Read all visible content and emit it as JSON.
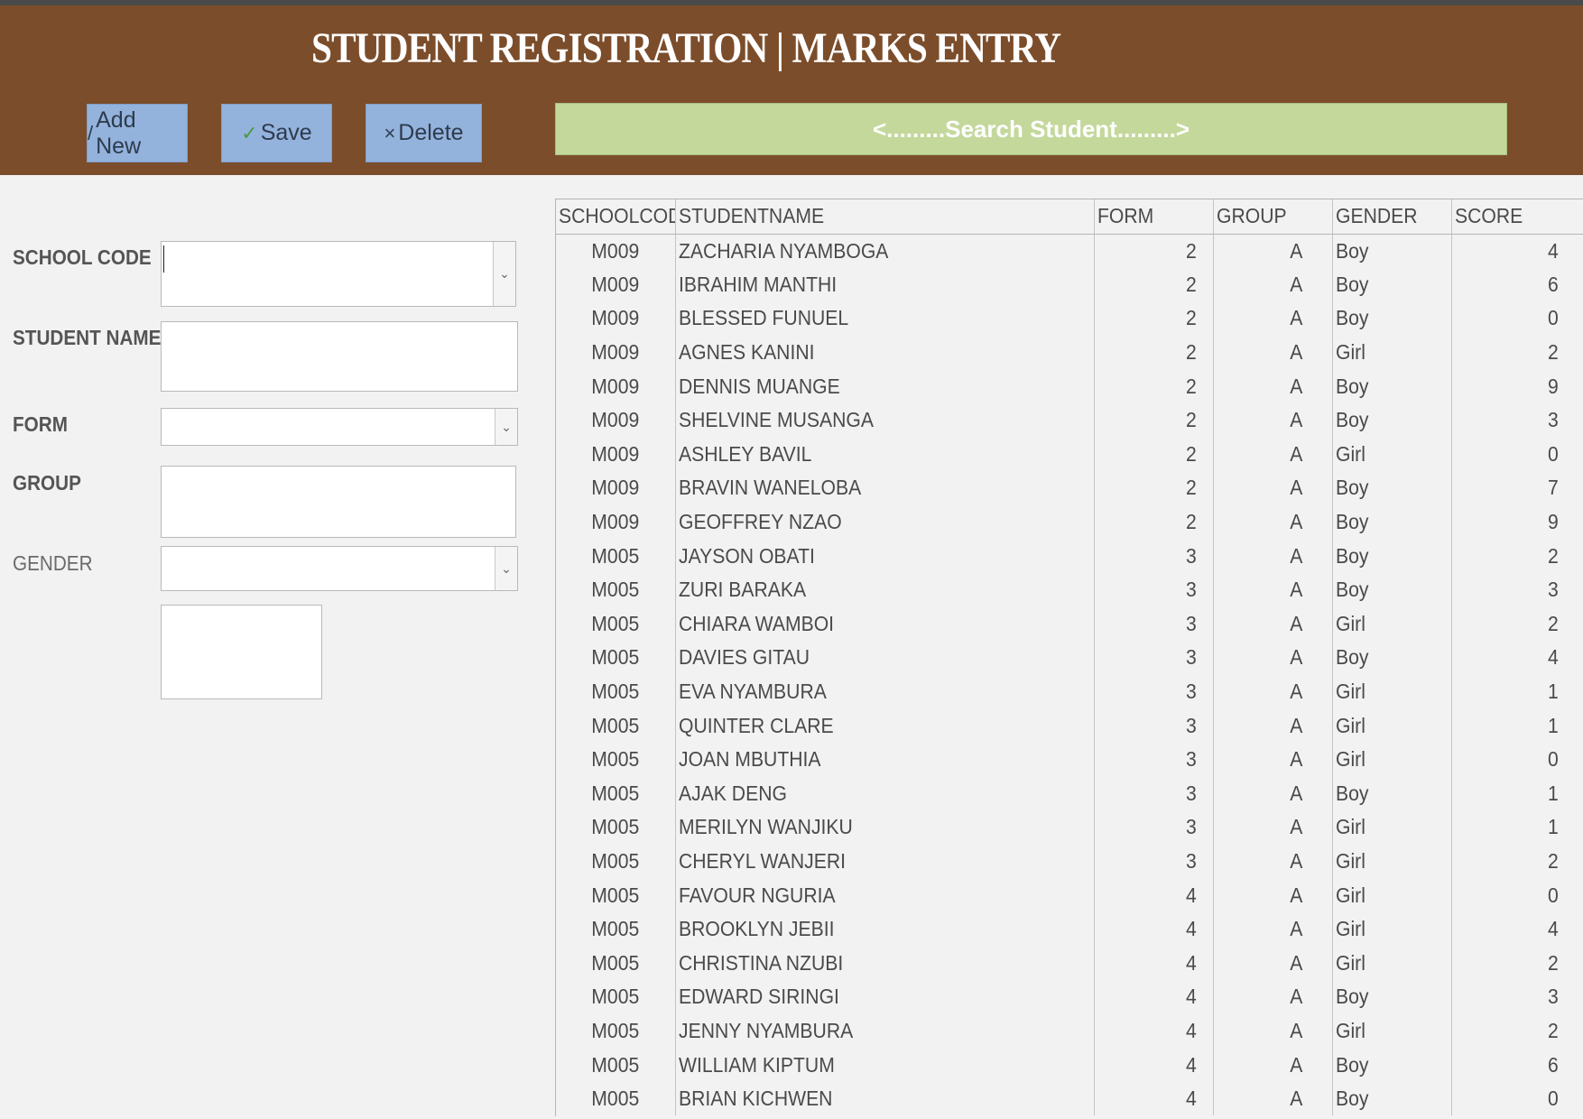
{
  "header": {
    "title": "STUDENT REGISTRATION | MARKS ENTRY",
    "buttons": {
      "add_new": {
        "icon": "pencil-icon",
        "glyph": "/",
        "label": "Add New"
      },
      "save": {
        "icon": "check-icon",
        "glyph": "✓",
        "label": "Save"
      },
      "delete": {
        "icon": "x-icon",
        "glyph": "×",
        "label": "Delete"
      }
    },
    "search_label": "<.........Search Student.........>"
  },
  "form": {
    "school_code_label": "SCHOOL CODE",
    "student_name_label": "STUDENT NAME",
    "form_label": "FORM",
    "group_label": "GROUP",
    "gender_label": "GENDER"
  },
  "colors": {
    "header_bg": "#7b4d2b",
    "button_bg": "#94b3dc",
    "search_bg": "#c4d89c"
  },
  "table": {
    "columns": [
      "SCHOOLCODE",
      "STUDENTNAME",
      "FORM",
      "GROUP",
      "GENDER",
      "SCORE"
    ],
    "rows": [
      [
        "M009",
        "ZACHARIA NYAMBOGA",
        "2",
        "A",
        "Boy",
        "4"
      ],
      [
        "M009",
        "IBRAHIM MANTHI",
        "2",
        "A",
        "Boy",
        "6"
      ],
      [
        "M009",
        "BLESSED FUNUEL",
        "2",
        "A",
        "Boy",
        "0"
      ],
      [
        "M009",
        "AGNES KANINI",
        "2",
        "A",
        "Girl",
        "2"
      ],
      [
        "M009",
        "DENNIS MUANGE",
        "2",
        "A",
        "Boy",
        "9"
      ],
      [
        "M009",
        "SHELVINE MUSANGA",
        "2",
        "A",
        "Boy",
        "3"
      ],
      [
        "M009",
        "ASHLEY BAVIL",
        "2",
        "A",
        "Girl",
        "0"
      ],
      [
        "M009",
        "BRAVIN WANELOBA",
        "2",
        "A",
        "Boy",
        "7"
      ],
      [
        "M009",
        "GEOFFREY NZAO",
        "2",
        "A",
        "Boy",
        "9"
      ],
      [
        "M005",
        "JAYSON OBATI",
        "3",
        "A",
        "Boy",
        "2"
      ],
      [
        "M005",
        "ZURI BARAKA",
        "3",
        "A",
        "Boy",
        "3"
      ],
      [
        "M005",
        "CHIARA WAMBOI",
        "3",
        "A",
        "Girl",
        "2"
      ],
      [
        "M005",
        "DAVIES GITAU",
        "3",
        "A",
        "Boy",
        "4"
      ],
      [
        "M005",
        "EVA NYAMBURA",
        "3",
        "A",
        "Girl",
        "1"
      ],
      [
        "M005",
        "QUINTER CLARE",
        "3",
        "A",
        "Girl",
        "1"
      ],
      [
        "M005",
        "JOAN MBUTHIA",
        "3",
        "A",
        "Girl",
        "0"
      ],
      [
        "M005",
        "AJAK DENG",
        "3",
        "A",
        "Boy",
        "1"
      ],
      [
        "M005",
        "MERILYN WANJIKU",
        "3",
        "A",
        "Girl",
        "1"
      ],
      [
        "M005",
        "CHERYL WANJERI",
        "3",
        "A",
        "Girl",
        "2"
      ],
      [
        "M005",
        "FAVOUR NGURIA",
        "4",
        "A",
        "Girl",
        "0"
      ],
      [
        "M005",
        "BROOKLYN JEBII",
        "4",
        "A",
        "Girl",
        "4"
      ],
      [
        "M005",
        "CHRISTINA NZUBI",
        "4",
        "A",
        "Girl",
        "2"
      ],
      [
        "M005",
        "EDWARD SIRINGI",
        "4",
        "A",
        "Boy",
        "3"
      ],
      [
        "M005",
        "JENNY NYAMBURA",
        "4",
        "A",
        "Girl",
        "2"
      ],
      [
        "M005",
        "WILLIAM KIPTUM",
        "4",
        "A",
        "Boy",
        "6"
      ],
      [
        "M005",
        "BRIAN KICHWEN",
        "4",
        "A",
        "Boy",
        "0"
      ]
    ]
  }
}
